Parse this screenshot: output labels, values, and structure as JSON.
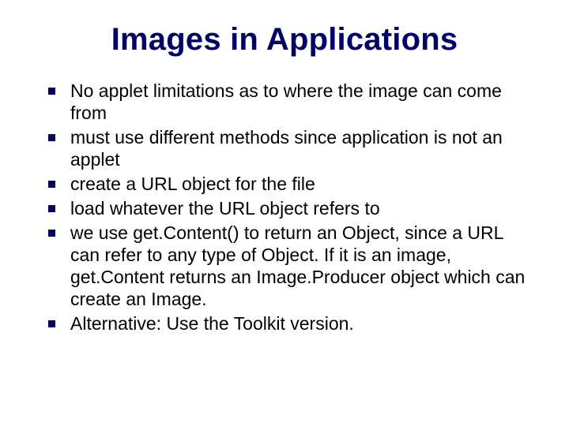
{
  "title": "Images in Applications",
  "bullets": [
    "No applet limitations as to where the image can come from",
    "must use different methods since application is not an applet",
    "create a URL object for the file",
    "load whatever the URL object refers to",
    "we use get.Content() to return an Object, since a URL can refer to any type of Object. If it is an image, get.Content returns an Image.Producer object which can create an Image.",
    "Alternative: Use the Toolkit version."
  ]
}
